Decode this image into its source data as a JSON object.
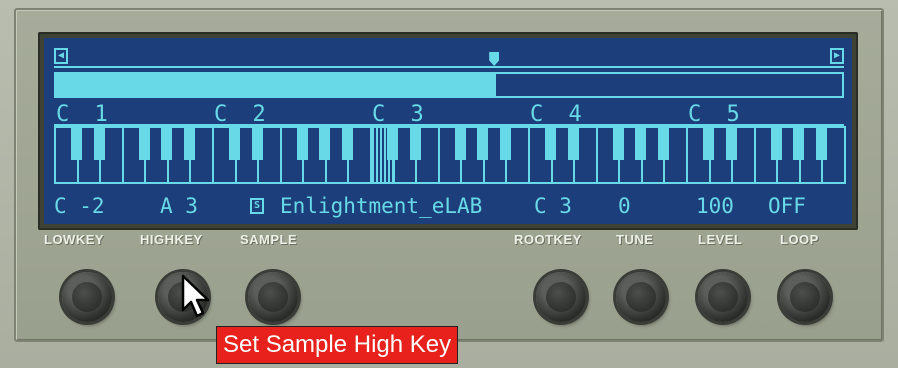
{
  "lcd": {
    "scroll_left_icon": "triangle-left",
    "scroll_right_icon": "triangle-right",
    "scroll_left_glyph": "◀",
    "scroll_right_glyph": "▶",
    "range_fill_fraction": 0.56,
    "octave_labels": [
      "C 1",
      "C 2",
      "C 3",
      "C 4",
      "C 5"
    ],
    "lowkey_value": "C -2",
    "highkey_value": "A 3",
    "sample_icon_glyph": "S",
    "sample_name": "Enlightment_eLAB",
    "rootkey_value": "C 3",
    "tune_value": "0",
    "level_value": "100",
    "loop_value": "OFF"
  },
  "labels": {
    "lowkey": "LOWKEY",
    "highkey": "HIGHKEY",
    "sample": "SAMPLE",
    "rootkey": "ROOTKEY",
    "tune": "TUNE",
    "level": "LEVEL",
    "loop": "LOOP"
  },
  "tooltip": {
    "text": "Set Sample High Key"
  },
  "colors": {
    "lcd_background": "#1c3f7c",
    "lcd_foreground": "#68d9e6",
    "tooltip_background": "#e8211c"
  }
}
